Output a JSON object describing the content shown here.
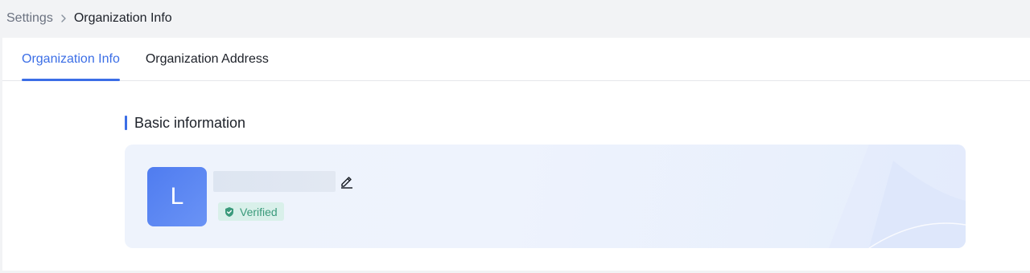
{
  "breadcrumb": {
    "root": "Settings",
    "separator_icon": "chevron-right-icon",
    "current": "Organization Info"
  },
  "tabs": [
    {
      "label": "Organization Info",
      "active": true
    },
    {
      "label": "Organization Address",
      "active": false
    }
  ],
  "section": {
    "title": "Basic information"
  },
  "org_card": {
    "avatar_letter": "L",
    "edit_icon": "pencil-icon",
    "verified_icon": "shield-check-icon",
    "verified_label": "Verified"
  },
  "colors": {
    "accent": "#3b6ee6",
    "verified_bg": "#d9f0ea",
    "verified_text": "#3a9a7b"
  }
}
